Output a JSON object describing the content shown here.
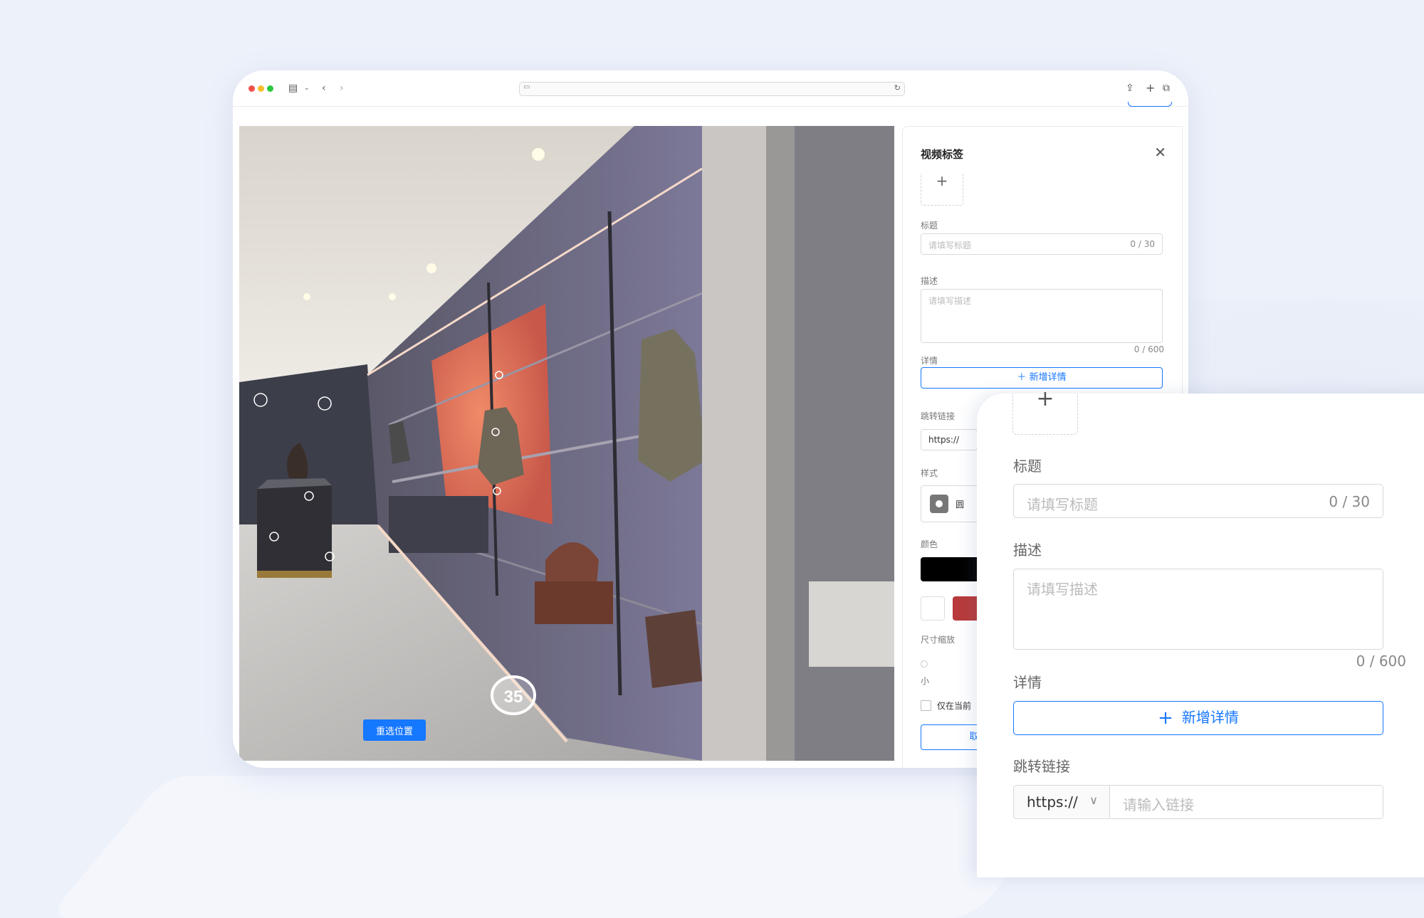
{
  "browser": {
    "icons": {
      "sidebar": "sidebar-icon",
      "back": "chevron-left-icon",
      "forward": "chevron-right-icon",
      "share": "share-icon",
      "new_tab": "plus-icon",
      "tabs": "tabs-overview-icon"
    }
  },
  "scene": {
    "hotspot_number": "35",
    "reselect_label": "重选位置"
  },
  "panel": {
    "title": "视频标签",
    "title_label": "标题",
    "title_placeholder": "请填写标题",
    "title_count": "0 / 30",
    "desc_label": "描述",
    "desc_placeholder": "请填写描述",
    "desc_count": "0 / 600",
    "details_label": "详情",
    "add_details": "新增详情",
    "link_label": "跳转链接",
    "protocol": "https://",
    "style_label": "样式",
    "style_value": "圆",
    "color_label": "颜色",
    "colors": [
      "#000000",
      "#ffffff",
      "#b83a3a"
    ],
    "size_label": "尺寸缩放",
    "size_min": "小",
    "only_current": "仅在当前",
    "cancel_partial": "取"
  },
  "zoom": {
    "title_label": "标题",
    "title_placeholder": "请填写标题",
    "title_count": "0 / 30",
    "desc_label": "描述",
    "desc_placeholder": "请填写描述",
    "desc_count": "0 / 600",
    "details_label": "详情",
    "add_details": "新增详情",
    "link_label": "跳转链接",
    "protocol": "https://",
    "link_placeholder": "请输入链接"
  }
}
